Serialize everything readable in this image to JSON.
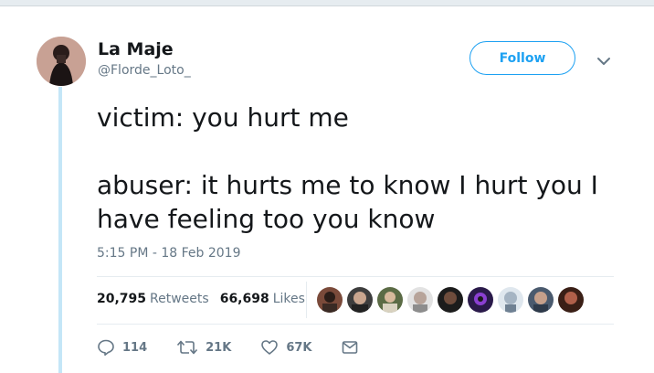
{
  "user": {
    "display_name": "La Maje",
    "handle": "@Florde_Loto_"
  },
  "follow_label": "Follow",
  "tweet": {
    "lines": [
      "victim: you hurt me",
      "abuser: it hurts me to know I hurt you I",
      "have feeling too you know"
    ],
    "timestamp": "5:15 PM - 18 Feb 2019"
  },
  "stats": {
    "retweets_count": "20,795",
    "retweets_label": "Retweets",
    "likes_count": "66,698",
    "likes_label": "Likes"
  },
  "actions": {
    "reply_count": "114",
    "retweet_count": "21K",
    "like_count": "67K"
  },
  "colors": {
    "accent": "#1da1f2",
    "muted": "#657786",
    "thread_line": "#c4e6f7"
  },
  "icons": [
    "chevron-down-icon",
    "reply-icon",
    "retweet-icon",
    "heart-icon",
    "message-icon"
  ]
}
